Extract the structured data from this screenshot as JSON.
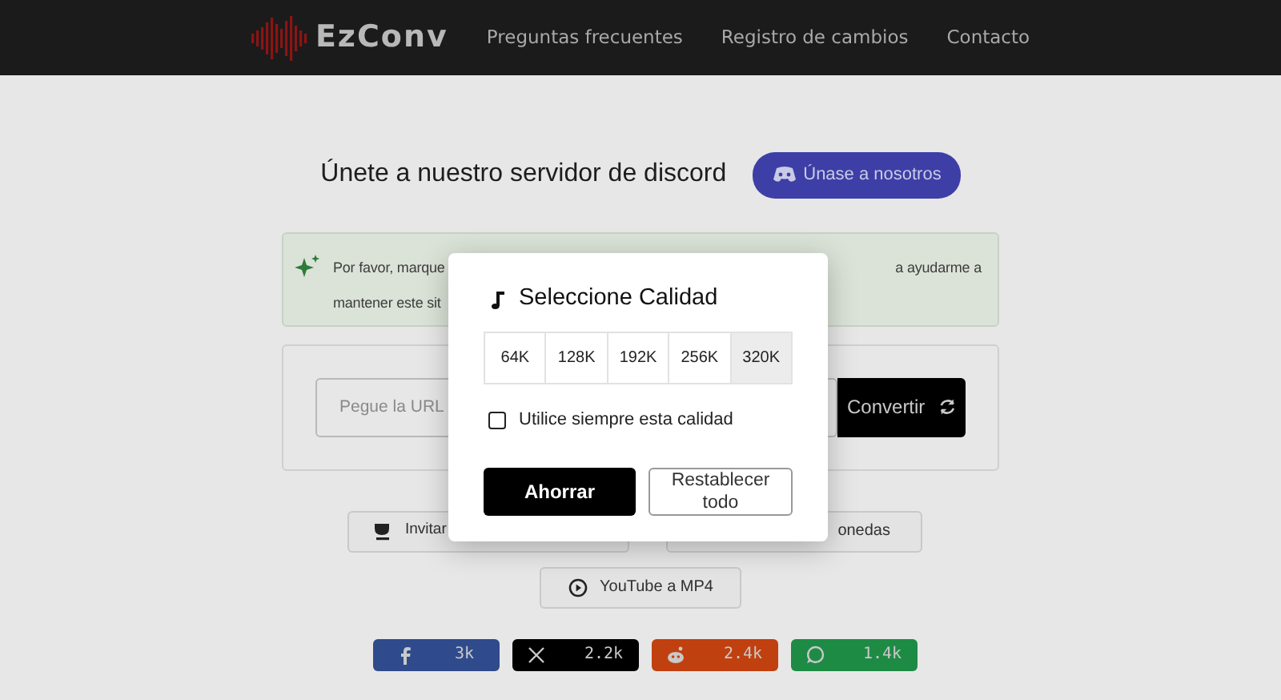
{
  "navbar": {
    "logo": "EzConv",
    "links": [
      "Preguntas frecuentes",
      "Registro de cambios",
      "Contacto"
    ]
  },
  "discord": {
    "text": "Únete a nuestro servidor de discord",
    "button": "Únase a nosotros"
  },
  "notice": {
    "lines": [
      [
        "Por favor, marque",
        "a ayudarme a"
      ],
      [
        "mantener este sit"
      ]
    ]
  },
  "converter": {
    "placeholder": "Pegue la URL",
    "button": "Convertir"
  },
  "tools": [
    {
      "kind": "coffee",
      "label": "Invitar"
    },
    {
      "kind": "plain",
      "label": "onedas"
    }
  ],
  "video_button": "YouTube a MP4",
  "share": [
    {
      "kind": "facebook",
      "count": "3k",
      "color": "#2f4b8c"
    },
    {
      "kind": "x",
      "count": "2.2k",
      "color": "#000000"
    },
    {
      "kind": "reddit",
      "count": "2.4k",
      "color": "#c1400f"
    },
    {
      "kind": "whatsapp",
      "count": "1.4k",
      "color": "#1e8b45"
    }
  ],
  "modal": {
    "title": "Seleccione Calidad",
    "qualities": [
      {
        "label": "64K",
        "selected": false
      },
      {
        "label": "128K",
        "selected": false
      },
      {
        "label": "192K",
        "selected": false
      },
      {
        "label": "256K",
        "selected": false
      },
      {
        "label": "320K",
        "selected": true
      }
    ],
    "always": {
      "label": "Utilice siempre esta calidad",
      "checked": false
    },
    "save": "Ahorrar",
    "reset": "Restablecer todo"
  }
}
